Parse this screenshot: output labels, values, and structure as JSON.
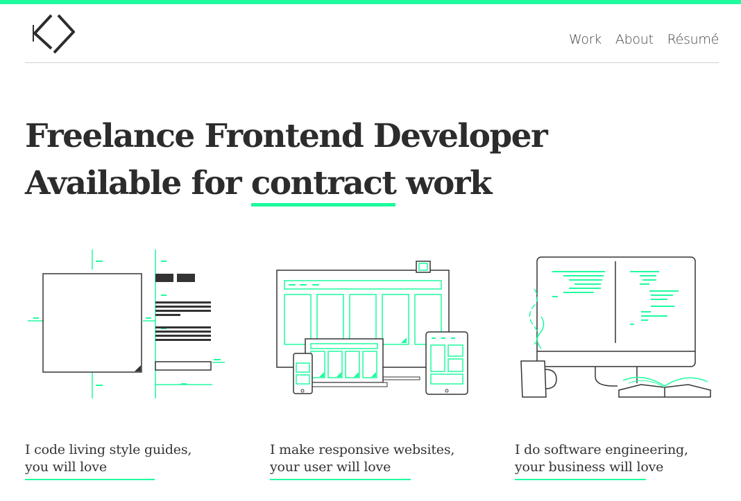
{
  "colors": {
    "accent": "#1dfc9e",
    "text": "#333333",
    "rule": "#cfcfcf"
  },
  "header": {
    "logo_icon": "code-brackets-logo",
    "nav": [
      {
        "label": "Work"
      },
      {
        "label": "About"
      },
      {
        "label": "Résumé"
      }
    ]
  },
  "hero": {
    "line1": "Freelance Frontend Developer",
    "line2_before": "Available for ",
    "line2_highlight": "contract",
    "line2_after": " work"
  },
  "services": [
    {
      "icon": "style-guide-illustration",
      "line1": "I code living style guides,",
      "line2": "you will love"
    },
    {
      "icon": "responsive-devices-illustration",
      "line1": "I make responsive websites,",
      "line2": "your user will love"
    },
    {
      "icon": "software-monitor-illustration",
      "line1": "I do software engineering,",
      "line2": "your business will love"
    }
  ]
}
